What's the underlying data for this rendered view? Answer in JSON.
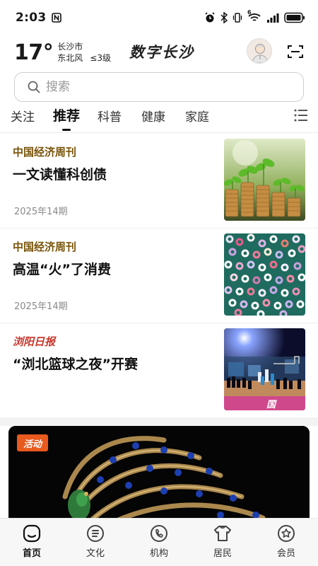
{
  "status_bar": {
    "time": "2:03",
    "icons": [
      "nfc-icon",
      "alarm-icon",
      "bluetooth-icon",
      "vibrate-icon",
      "wifi-icon",
      "signal-icon",
      "battery-icon"
    ],
    "wifi_label": "6"
  },
  "header": {
    "temperature": "17°",
    "city": "长沙市",
    "wind": "东北风",
    "wind_level": "≤3级",
    "brand": "数字长沙"
  },
  "search": {
    "placeholder": "搜索"
  },
  "tabs": [
    {
      "label": "关注",
      "active": false
    },
    {
      "label": "推荐",
      "active": true
    },
    {
      "label": "科普",
      "active": false
    },
    {
      "label": "健康",
      "active": false
    },
    {
      "label": "家庭",
      "active": false
    }
  ],
  "articles": [
    {
      "source": "中国经济周刊",
      "title": "一文读懂科创债",
      "date": "2025年14期",
      "image": "coins-plants-image"
    },
    {
      "source": "中国经济周刊",
      "title": "高温“火”了消费",
      "date": "2025年14期",
      "image": "colorful-rings-image"
    },
    {
      "source": "浏阳日报",
      "title": "“浏北篮球之夜”开赛",
      "date": "",
      "image": "basketball-night-image"
    }
  ],
  "banner": {
    "tag": "活动",
    "image": "peacock-sculpture-image"
  },
  "bottom_nav": [
    {
      "label": "首页",
      "icon": "home-icon",
      "active": true
    },
    {
      "label": "文化",
      "icon": "culture-icon",
      "active": false
    },
    {
      "label": "机构",
      "icon": "institution-icon",
      "active": false
    },
    {
      "label": "居民",
      "icon": "resident-icon",
      "active": false
    },
    {
      "label": "会员",
      "icon": "member-icon",
      "active": false
    }
  ],
  "colors": {
    "source_brown": "#7a5408",
    "source_red": "#c8372d",
    "banner_tag": "#e85a1e"
  }
}
